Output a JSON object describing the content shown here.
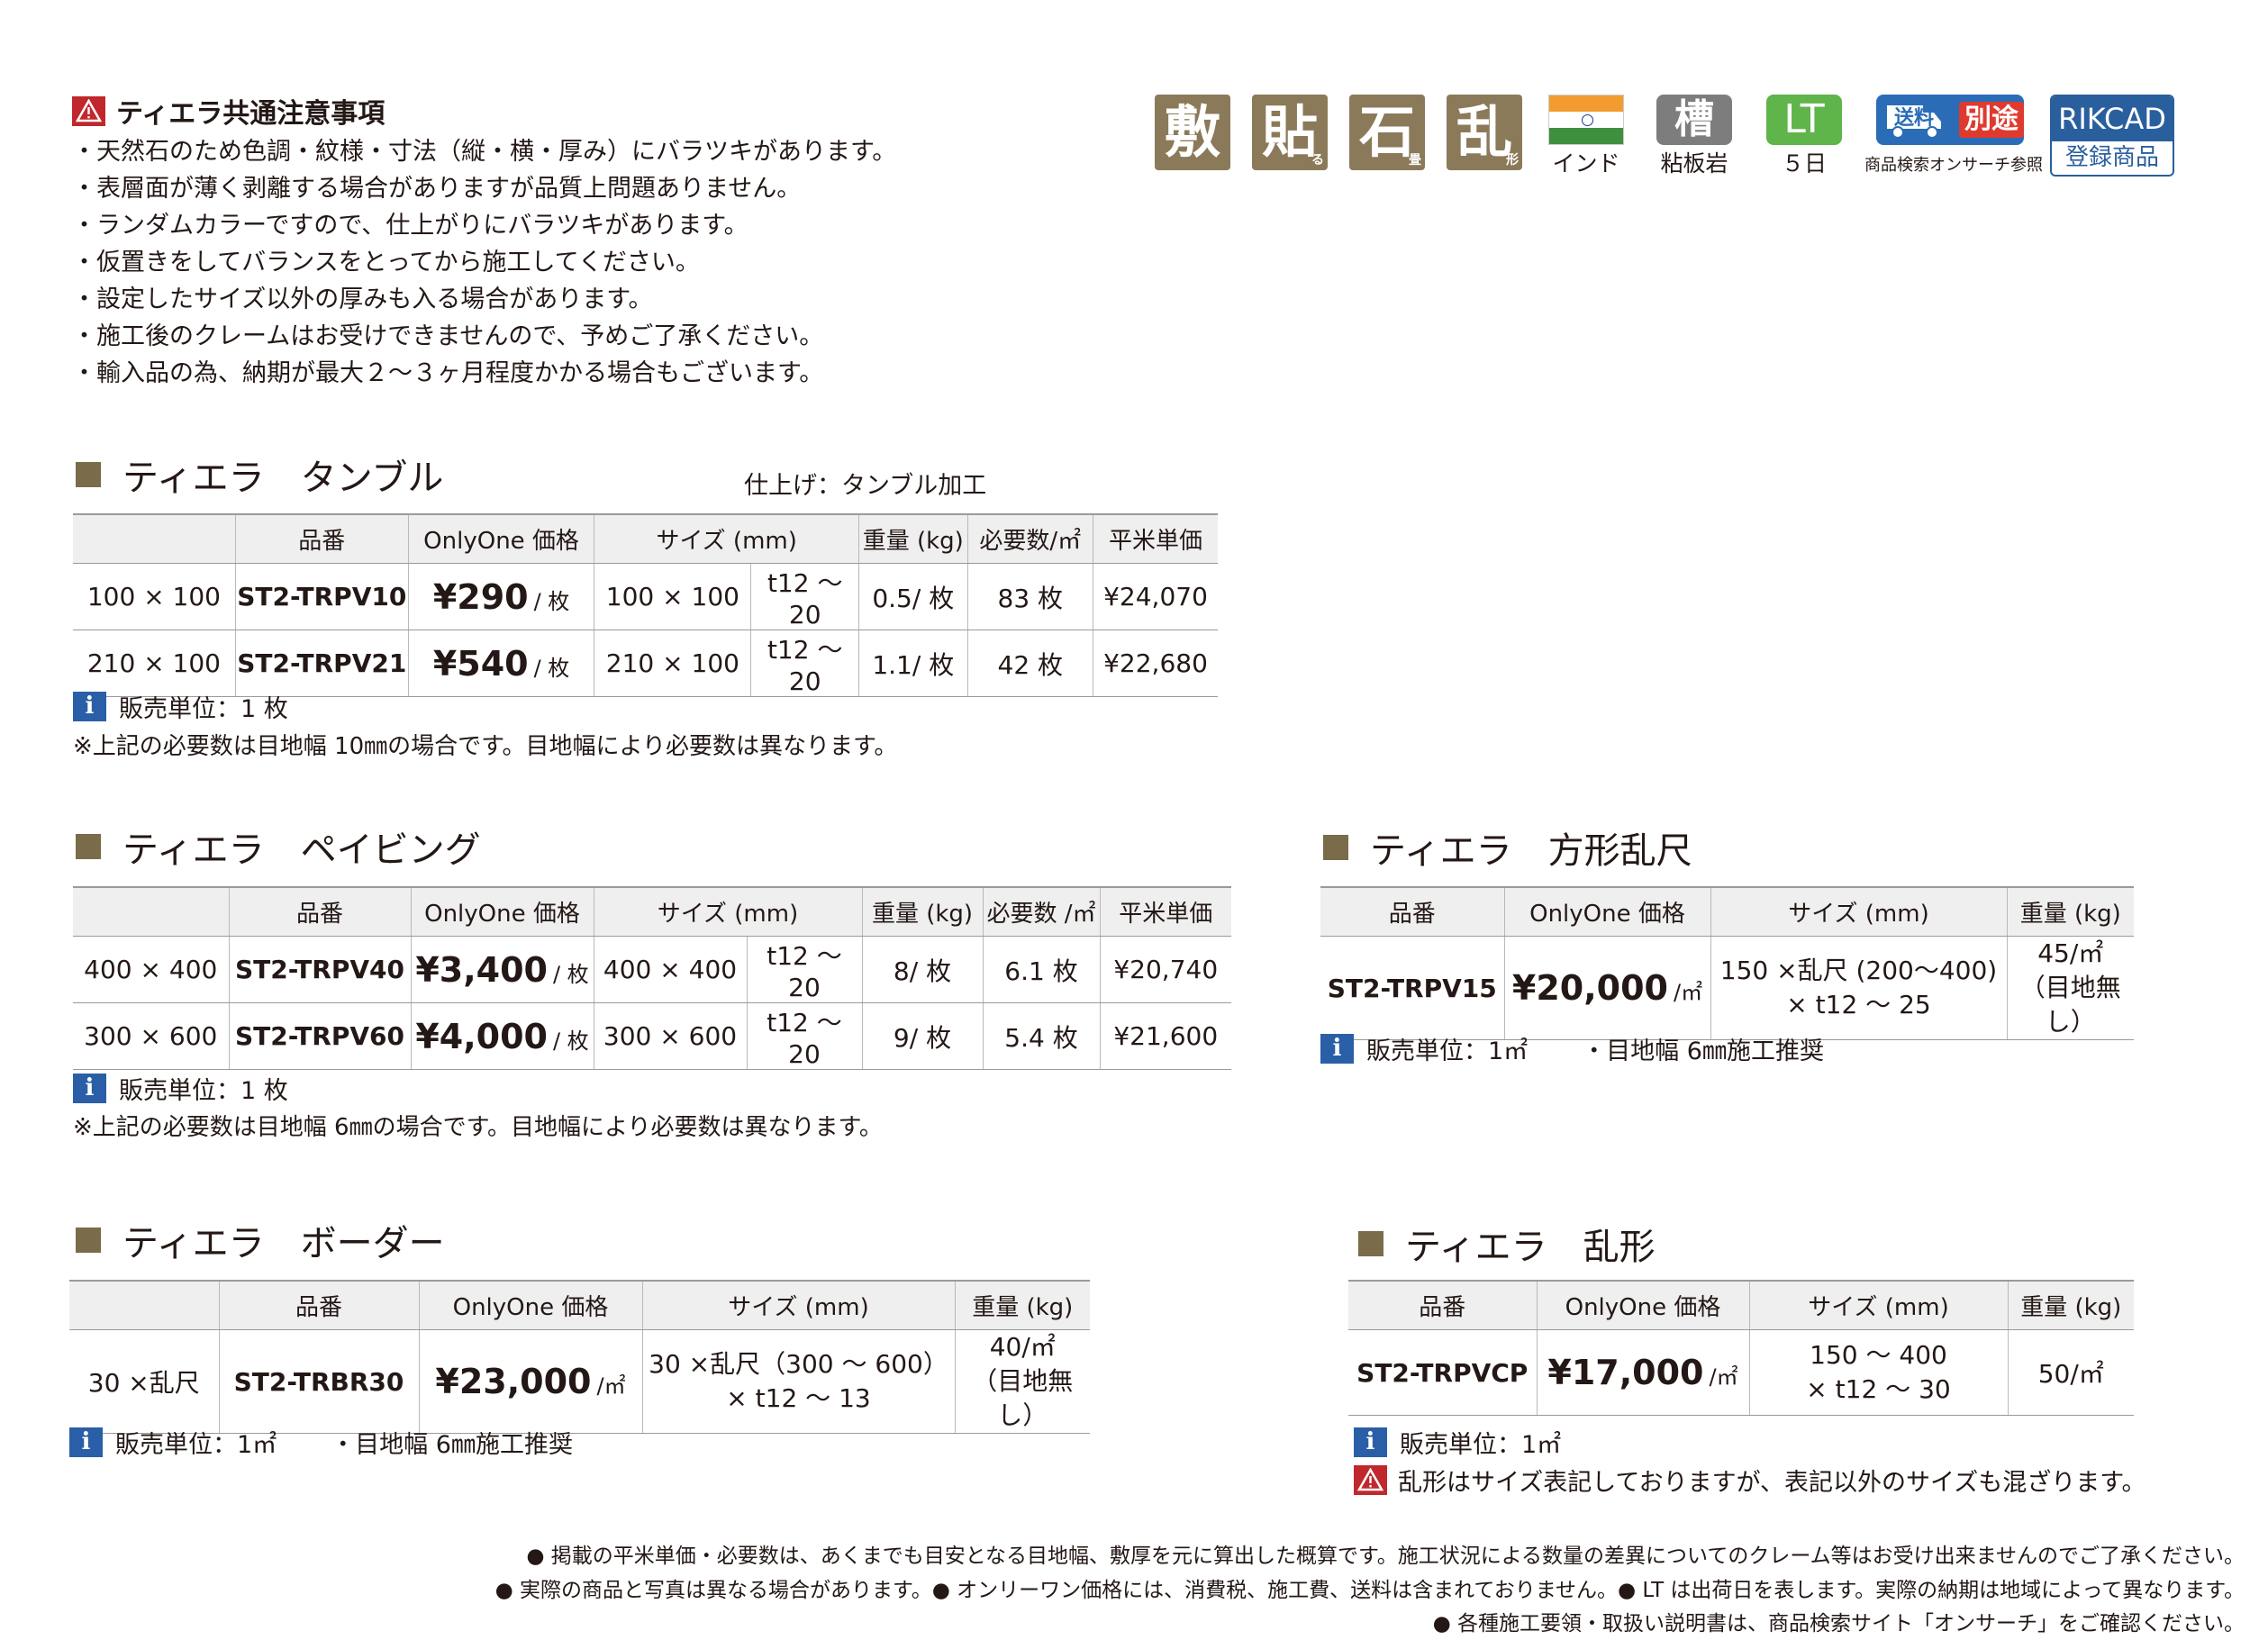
{
  "caution": {
    "title": "ティエラ共通注意事項",
    "items": [
      "・天然石のため色調・紋様・寸法（縦・横・厚み）にバラツキがあります。",
      "・表層面が薄く剥離する場合がありますが品質上問題ありません。",
      "・ランダムカラーですので、仕上がりにバラツキがあります。",
      "・仮置きをしてバランスをとってから施工してください。",
      "・設定したサイズ以外の厚みも入る場合があります。",
      "・施工後のクレームはお受けできませんので、予めご了承ください。",
      "・輸入品の為、納期が最大２～３ヶ月程度かかる場合もございます。"
    ]
  },
  "icons": {
    "usage": [
      {
        "main": "敷",
        "sub": ""
      },
      {
        "main": "貼",
        "sub": "る"
      },
      {
        "main": "石",
        "sub": "畳"
      },
      {
        "main": "乱",
        "sub": "形"
      }
    ],
    "origin_label": "インド",
    "stone_glyph": "槽",
    "stone_label": "粘板岩",
    "lt_glyph": "LT",
    "lt_label": "５日",
    "ship_text": "送料",
    "ship_sep": "別途",
    "ship_label": "商品検索オンサーチ参照",
    "rikcad_top": "RIKCAD",
    "rikcad_bottom": "登録商品",
    "colors": {
      "usage": "#8b7a59",
      "stone": "#7d7d7d",
      "lt": "#5fb44a",
      "ship": "#2a6db6",
      "rikcad": "#2a5f9e",
      "caution": "#c0282d",
      "info": "#2a5fa8"
    }
  },
  "tumble": {
    "title": "ティエラ　タンブル",
    "finish": "仕上げ：タンブル加工",
    "headers": [
      "",
      "品番",
      "OnlyOne 価格",
      "サイズ (mm)",
      "重量 (kg)",
      "必要数/㎡",
      "平米単価"
    ],
    "rows": [
      {
        "label": "100 × 100",
        "code": "ST2-TRPV10",
        "price": "¥290",
        "price_unit": "/ 枚",
        "size": "100 × 100",
        "thick": "t12 ～ 20",
        "weight": "0.5/ 枚",
        "qty": "83 枚",
        "sqm": "¥24,070"
      },
      {
        "label": "210 × 100",
        "code": "ST2-TRPV21",
        "price": "¥540",
        "price_unit": "/ 枚",
        "size": "210 × 100",
        "thick": "t12 ～ 20",
        "weight": "1.1/ 枚",
        "qty": "42 枚",
        "sqm": "¥22,680"
      }
    ],
    "unit_note": "販売単位：1 枚",
    "sub_note": "※上記の必要数は目地幅 10㎜の場合です。目地幅により必要数は異なります。"
  },
  "paving": {
    "title": "ティエラ　ペイビング",
    "headers": [
      "",
      "品番",
      "OnlyOne 価格",
      "サイズ (mm)",
      "重量 (kg)",
      "必要数 /㎡",
      "平米単価"
    ],
    "rows": [
      {
        "label": "400 × 400",
        "code": "ST2-TRPV40",
        "price": "¥3,400",
        "price_unit": "/ 枚",
        "size": "400 × 400",
        "thick": "t12 ～ 20",
        "weight": "8/ 枚",
        "qty": "6.1 枚",
        "sqm": "¥20,740"
      },
      {
        "label": "300 × 600",
        "code": "ST2-TRPV60",
        "price": "¥4,000",
        "price_unit": "/ 枚",
        "size": "300 × 600",
        "thick": "t12 ～ 20",
        "weight": "9/ 枚",
        "qty": "5.4 枚",
        "sqm": "¥21,600"
      }
    ],
    "unit_note": "販売単位：1 枚",
    "sub_note": "※上記の必要数は目地幅 6㎜の場合です。目地幅により必要数は異なります。"
  },
  "square": {
    "title": "ティエラ　方形乱尺",
    "headers": [
      "品番",
      "OnlyOne 価格",
      "サイズ (mm)",
      "重量 (kg)"
    ],
    "row": {
      "code": "ST2-TRPV15",
      "price": "¥20,000",
      "price_unit": "/㎡",
      "size1": "150 ×乱尺 (200～400)",
      "size2": "× t12 ～ 25",
      "weight1": "45/㎡",
      "weight2": "（目地無し）"
    },
    "unit_note": "販売単位：1㎡",
    "joint_note": "・目地幅 6㎜施工推奨"
  },
  "border": {
    "title": "ティエラ　ボーダー",
    "headers": [
      "",
      "品番",
      "OnlyOne 価格",
      "サイズ (mm)",
      "重量 (kg)"
    ],
    "row": {
      "label": "30 ×乱尺",
      "code": "ST2-TRBR30",
      "price": "¥23,000",
      "price_unit": "/㎡",
      "size1": "30 ×乱尺（300 ～ 600）",
      "size2": "× t12 ～ 13",
      "weight1": "40/㎡",
      "weight2": "（目地無し）"
    },
    "unit_note": "販売単位：1㎡",
    "joint_note": "・目地幅 6㎜施工推奨"
  },
  "random": {
    "title": "ティエラ　乱形",
    "headers": [
      "品番",
      "OnlyOne 価格",
      "サイズ (mm)",
      "重量 (kg)"
    ],
    "row": {
      "code": "ST2-TRPVCP",
      "price": "¥17,000",
      "price_unit": "/㎡",
      "size1": "150 ～ 400",
      "size2": "× t12 ～ 30",
      "weight": "50/㎡"
    },
    "unit_note": "販売単位：1㎡",
    "warn_note": "乱形はサイズ表記しておりますが、表記以外のサイズも混ざります。"
  },
  "footer": [
    "● 掲載の平米単価・必要数は、あくまでも目安となる目地幅、敷厚を元に算出した概算です。施工状況による数量の差異についてのクレーム等はお受け出来ませんのでご了承ください。",
    "● 実際の商品と写真は異なる場合があります。● オンリーワン価格には、消費税、施工費、送料は含まれておりません。● LT は出荷日を表します。実際の納期は地域によって異なります。",
    "● 各種施工要領・取扱い説明書は、商品検索サイト「オンサーチ」をご確認ください。"
  ]
}
